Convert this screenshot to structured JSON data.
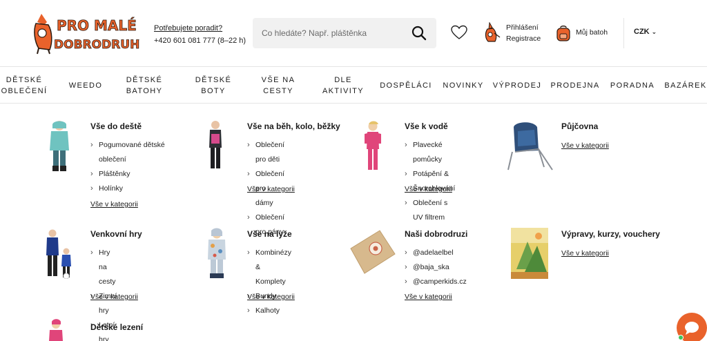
{
  "header": {
    "logo_text": "Pro malé dobrodruhy",
    "help_question": "Potřebujete poradit?",
    "help_phone": "+420 601 081 777 (8–22 h)",
    "search_placeholder": "Co hledáte? Např. pláštěnka",
    "login_label": "Přihlášení",
    "register_label": "Registrace",
    "cart_label": "Můj batoh",
    "currency": "CZK",
    "icons": [
      "logo-fox",
      "search-icon",
      "heart-icon",
      "fox-user-icon",
      "backpack-icon",
      "chevron-down-icon"
    ]
  },
  "nav": [
    "Dětské oblečení",
    "Weedo",
    "Dětské batohy",
    "Dětské boty",
    "Vše na cesty",
    "Dle aktivity",
    "Dospěláci",
    "Novinky",
    "Výprodej",
    "Prodejna",
    "Poradna",
    "Bazárek"
  ],
  "menu": {
    "all_label": "Vše v kategorii",
    "categories": [
      {
        "title": "Vše do deště",
        "items": [
          "Pogumované dětské oblečení",
          "Pláštěnky",
          "Holínky"
        ]
      },
      {
        "title": "Vše na běh, kolo, běžky",
        "items": [
          "Oblečení pro děti",
          "Oblečení pro dámy",
          "Oblečení pro pány"
        ]
      },
      {
        "title": "Vše k vodě",
        "items": [
          "Plavecké pomůcky",
          "Potápění & Šnorchlování",
          "Oblečení s UV filtrem"
        ]
      },
      {
        "title": "Půjčovna",
        "items": []
      },
      {
        "title": "Venkovní hry",
        "items": [
          "Hry na cesty",
          "Zimní hry",
          "Letní hry"
        ]
      },
      {
        "title": "Vše na lyže",
        "items": [
          "Kombinézy & Komplety",
          "Bundy",
          "Kalhoty"
        ]
      },
      {
        "title": "Naši dobrodruzi",
        "items": [
          "@adelaelbel",
          "@baja_ska",
          "@camperkids.cz"
        ]
      },
      {
        "title": "Výpravy, kurzy, vouchery",
        "items": []
      },
      {
        "title": "Dětské lezení",
        "items": []
      }
    ]
  },
  "colors": {
    "brand_orange": "#e9622b",
    "search_bg": "#f1f1f1",
    "text": "#1a1a1a"
  }
}
